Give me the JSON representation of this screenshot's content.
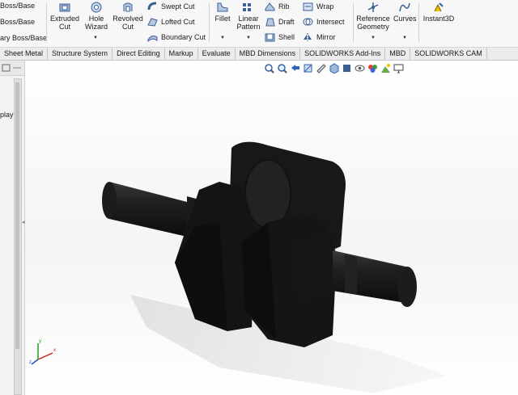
{
  "ribbon": {
    "boss_items": [
      "Boss/Base",
      "Boss/Base",
      "ary Boss/Base"
    ],
    "extruded_cut": "Extruded Cut",
    "hole_wizard": "Hole Wizard",
    "revolved_cut": "Revolved Cut",
    "swept_cut": "Swept Cut",
    "lofted_cut": "Lofted Cut",
    "boundary_cut": "Boundary Cut",
    "fillet": "Fillet",
    "linear_pattern": "Linear Pattern",
    "rib": "Rib",
    "draft": "Draft",
    "shell": "Shell",
    "wrap": "Wrap",
    "intersect": "Intersect",
    "mirror": "Mirror",
    "reference_geometry": "Reference Geometry",
    "curves": "Curves",
    "instant3d": "Instant3D"
  },
  "tabs": [
    "Sheet Metal",
    "Structure System",
    "Direct Editing",
    "Markup",
    "Evaluate",
    "MBD Dimensions",
    "SOLIDWORKS Add-Ins",
    "MBD",
    "SOLIDWORKS CAM"
  ],
  "left_panel": {
    "label": "play"
  },
  "triad": {
    "x": "x",
    "y": "y",
    "z": "z"
  },
  "colors": {
    "part": "#1b1b1b",
    "accent_blue": "#2a64b4",
    "ribbon_bg": "#f7f7f7",
    "tab_bg": "#ececec"
  },
  "icons": [
    "zoom-fit-icon",
    "zoom-area-icon",
    "previous-view-icon",
    "section-view-icon",
    "dynamic-annotation-icon",
    "view-orientation-icon",
    "display-style-icon",
    "hide-show-icon",
    "appearance-icon",
    "scene-icon",
    "monitor-icon"
  ]
}
